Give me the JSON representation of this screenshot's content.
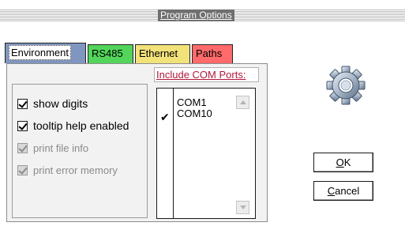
{
  "window": {
    "title": "Program Options"
  },
  "tabs": [
    {
      "label": "Environment",
      "color": "#7f96c0",
      "active": true
    },
    {
      "label": "RS485",
      "color": "#52d55a",
      "active": false
    },
    {
      "label": "Ethernet",
      "color": "#f2e27a",
      "active": false
    },
    {
      "label": "Paths",
      "color": "#ff6a6a",
      "active": false
    }
  ],
  "environment": {
    "options": [
      {
        "label": "show digits",
        "checked": true,
        "enabled": true
      },
      {
        "label": "tooltip help enabled",
        "checked": true,
        "enabled": true
      },
      {
        "label": "print file info",
        "checked": true,
        "enabled": false
      },
      {
        "label": "print error memory",
        "checked": true,
        "enabled": false
      }
    ]
  },
  "com_ports": {
    "header": "Include COM Ports:",
    "header_color": "#b0183a",
    "items": [
      {
        "label": "COM1",
        "checked": false
      },
      {
        "label": "COM10",
        "checked": true
      }
    ]
  },
  "buttons": {
    "ok": {
      "accel": "O",
      "rest": "K"
    },
    "cancel": {
      "accel": "C",
      "rest": "ancel"
    }
  },
  "icons": {
    "gear": "gear-icon",
    "scroll_up": "scroll-up-arrow-icon",
    "scroll_down": "scroll-down-arrow-icon"
  }
}
